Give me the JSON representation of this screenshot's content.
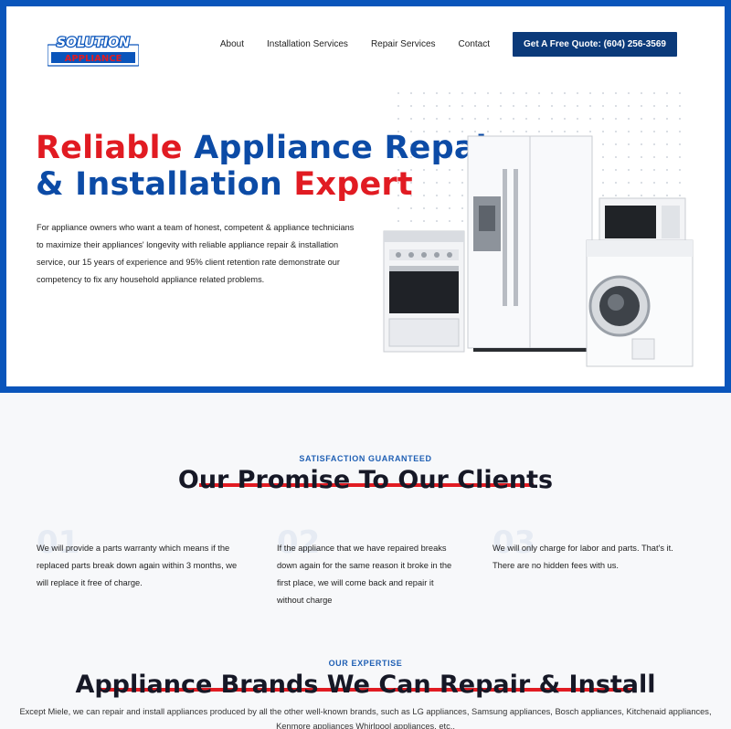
{
  "header": {
    "logo_top": "SOLUTION",
    "logo_bottom": "APPLIANCE",
    "nav": [
      "About",
      "Installation Services",
      "Repair Services",
      "Contact"
    ],
    "cta": "Get A Free Quote: (604) 256-3569"
  },
  "hero": {
    "title_1": "Reliable",
    "title_2": " Appliance Repair",
    "title_3": "& Installation",
    "title_4": " Expert",
    "description": "For appliance owners who want a team of honest, competent & appliance technicians to maximize their appliances' longevity with reliable appliance repair & installation service, our 15 years of experience and 95% client retention rate demonstrate our competency to fix any household appliance related problems."
  },
  "promise": {
    "kicker": "SATISFACTION GUARANTEED",
    "title": "Our Promise To Our Clients",
    "items": [
      {
        "num": "01",
        "text": "We will provide a parts warranty which means if the replaced parts break down again within 3 months, we will replace it free of charge."
      },
      {
        "num": "02",
        "text": "If the appliance that we have repaired breaks down again for the same reason it broke in the first place, we will come back and repair it without charge"
      },
      {
        "num": "03",
        "text": "We will only charge for labor and parts. That's it. There are no hidden fees with us."
      }
    ]
  },
  "brands": {
    "kicker": "OUR EXPERTISE",
    "title": "Appliance Brands We Can Repair & Install",
    "description": "Except Miele, we can repair and install appliances produced by all the other well-known brands, such as LG appliances, Samsung appliances, Bosch appliances, Kitchenaid appliances, Kenmore appliances Whirlpool appliances, etc.."
  },
  "colors": {
    "brand_blue": "#0a55bb",
    "brand_red": "#e11b22",
    "navy": "#0b3a7a"
  }
}
